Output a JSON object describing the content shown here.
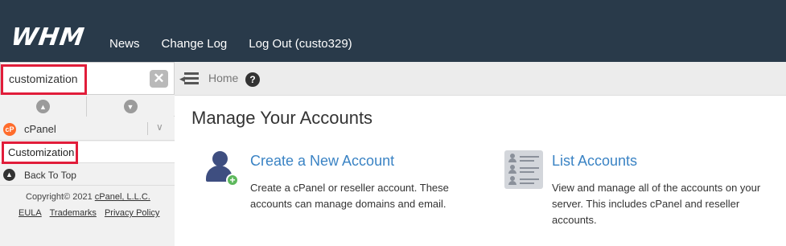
{
  "header": {
    "logo_text": "WHM",
    "nav": [
      {
        "label": "News"
      },
      {
        "label": "Change Log"
      },
      {
        "label": "Log Out (custo329)"
      }
    ]
  },
  "sidebar": {
    "search_value": "customization",
    "clear_icon": "x-icon",
    "expand_all_icon": "chevron-up-circle-icon",
    "collapse_all_icon": "chevron-down-circle-icon",
    "group": {
      "label": "cPanel",
      "icon": "cpanel-icon",
      "chevron": "chevron-down-icon"
    },
    "items": [
      {
        "label": "Customization"
      }
    ],
    "back_to_top": "Back To Top",
    "footer": {
      "copyright_prefix": "Copyright© 2021 ",
      "copyright_link": "cPanel, L.L.C.",
      "links": [
        "EULA",
        "Trademarks",
        "Privacy Policy"
      ]
    },
    "highlight_color": "#e11d3a"
  },
  "breadcrumb": {
    "home": "Home",
    "menu_icon": "menu-toggle-icon",
    "help_icon": "help-icon"
  },
  "main": {
    "section_title": "Manage Your Accounts",
    "cards": [
      {
        "title": "Create a New Account",
        "description": "Create a cPanel or reseller account. These accounts can manage domains and email.",
        "icon": "add-user-icon"
      },
      {
        "title": "List Accounts",
        "description": "View and manage all of the accounts on your server. This includes cPanel and reseller accounts.",
        "icon": "list-accounts-icon"
      }
    ]
  },
  "colors": {
    "header_bg": "#293a4a",
    "link": "#3a83c4",
    "sidebar_bg": "#f1f1f1",
    "highlight": "#e11d3a"
  }
}
